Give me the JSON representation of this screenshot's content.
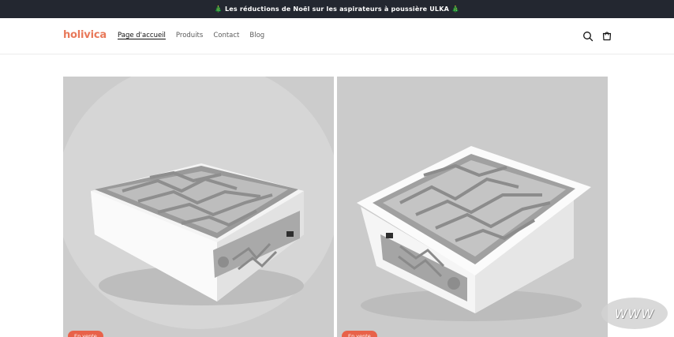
{
  "announcement": {
    "text": "🎄 Les réductions de Noël sur les aspirateurs à poussière ULKA 🎄"
  },
  "header": {
    "logo": "holivica",
    "nav": [
      {
        "label": "Page d'accueil",
        "active": true
      },
      {
        "label": "Produits",
        "active": false
      },
      {
        "label": "Contact",
        "active": false
      },
      {
        "label": "Blog",
        "active": false
      }
    ],
    "icons": [
      "search-icon",
      "cart-icon"
    ]
  },
  "gallery": {
    "items": [
      {
        "badge": "En vente"
      },
      {
        "badge": "En vente"
      }
    ]
  },
  "watermark": {
    "text": "WWW"
  },
  "colors": {
    "announcement_bg": "#232730",
    "brand": "#e8795a",
    "badge": "#e8624a"
  }
}
